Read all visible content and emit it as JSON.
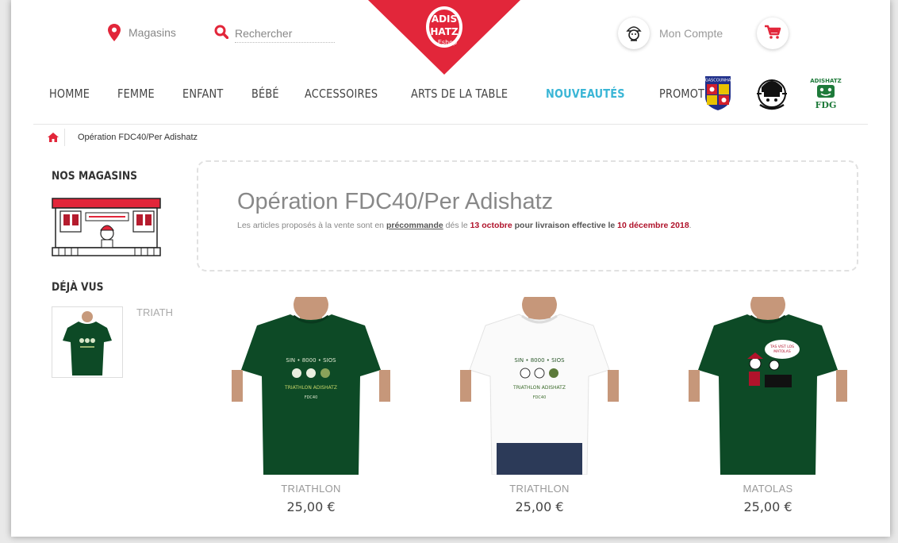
{
  "header": {
    "stores_label": "Magasins",
    "search_placeholder": "Rechercher",
    "account_label": "Mon Compte",
    "logo_text_top": "ADIS",
    "logo_text_bottom": "HATZ",
    "logo_sub": "Eshop"
  },
  "nav": {
    "items": [
      {
        "label": "HOMME"
      },
      {
        "label": "FEMME"
      },
      {
        "label": "ENFANT"
      },
      {
        "label": "BÉBÉ"
      },
      {
        "label": "ACCESSOIRES"
      },
      {
        "label": "ARTS DE LA TABLE"
      },
      {
        "label": "NOUVEAUTÉS",
        "active": true
      },
      {
        "label": "PROMOTIONS"
      }
    ],
    "badges": [
      {
        "label": "GASCOUNHA",
        "icon": "gascony-crest-icon"
      },
      {
        "label": "",
        "icon": "character-logo-icon"
      },
      {
        "label": "FDG",
        "icon": "fdg-logo-icon"
      }
    ]
  },
  "breadcrumb": {
    "current": "Opération FDC40/Per Adishatz"
  },
  "sidebar": {
    "stores_title": "NOS MAGASINS",
    "seen_title": "DÉJÀ VUS",
    "seen_item_label": "TRIATHLON"
  },
  "intro": {
    "title": "Opération FDC40/Per Adishatz",
    "text_1": "Les articles proposés à la vente sont en ",
    "text_precommande": "précommande",
    "text_2": " dés le ",
    "text_date1": "13 octobre",
    "text_3": " pour livraison effective le ",
    "text_date2": "10 décembre 2018",
    "text_4": "."
  },
  "products": [
    {
      "name": "TRIATHLON",
      "price": "25,00 €",
      "shirt_color": "#0d4a26"
    },
    {
      "name": "TRIATHLON",
      "price": "25,00 €",
      "shirt_color": "#fafafa"
    },
    {
      "name": "MATOLAS",
      "price": "25,00 €",
      "shirt_color": "#0d4a26"
    }
  ],
  "colors": {
    "brand_red": "#e2263a",
    "active_nav": "#3bb6d6",
    "date_red": "#b0132b"
  }
}
